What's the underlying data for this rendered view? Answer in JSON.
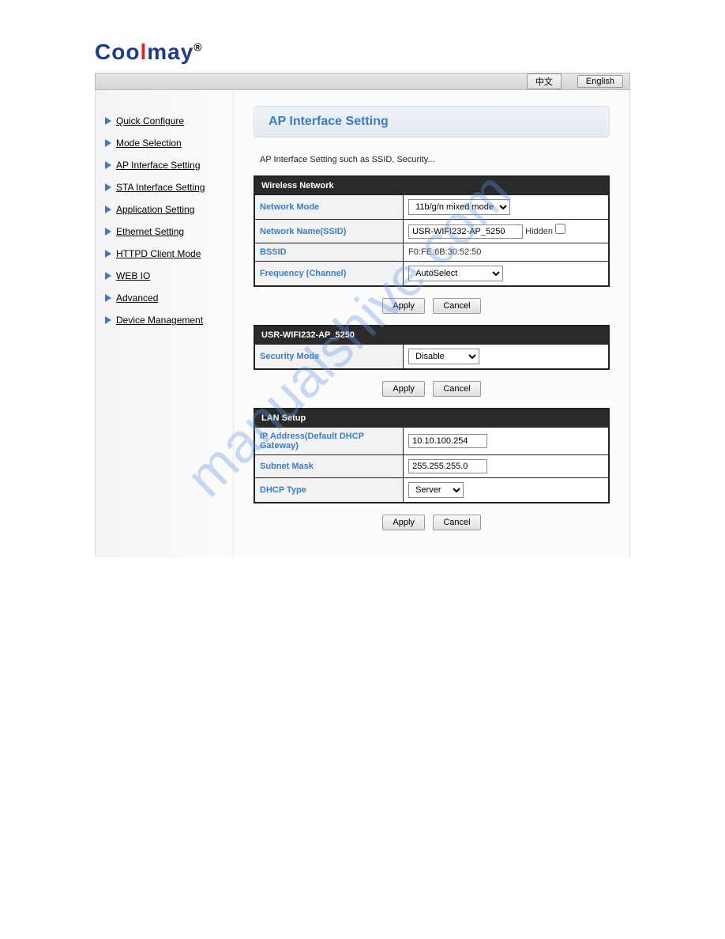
{
  "logo_text": "Coolmay",
  "lang": {
    "chinese": "中文",
    "english": "English"
  },
  "sidebar": {
    "items": [
      {
        "label": "Quick Configure"
      },
      {
        "label": "Mode Selection"
      },
      {
        "label": "AP Interface Setting"
      },
      {
        "label": "STA Interface Setting"
      },
      {
        "label": "Application Setting"
      },
      {
        "label": "Ethernet Setting"
      },
      {
        "label": "HTTPD Client Mode"
      },
      {
        "label": "WEB IO"
      },
      {
        "label": "Advanced"
      },
      {
        "label": "Device Management"
      }
    ]
  },
  "page": {
    "title": "AP Interface Setting",
    "description": "AP Interface Setting such as SSID, Security..."
  },
  "wireless": {
    "head": "Wireless Network",
    "network_mode_label": "Network Mode",
    "network_mode_value": "11b/g/n mixed mode",
    "ssid_label": "Network Name(SSID)",
    "ssid_value": "USR-WIFI232-AP_5250",
    "hidden_label": "Hidden",
    "bssid_label": "BSSID",
    "bssid_value": "F0:FE:6B:30:52:50",
    "frequency_label": "Frequency (Channel)",
    "frequency_value": "AutoSelect"
  },
  "security": {
    "head": "USR-WIFI232-AP_5250",
    "mode_label": "Security Mode",
    "mode_value": "Disable"
  },
  "lan": {
    "head": "LAN Setup",
    "ip_label": "IP Address(Default DHCP Gateway)",
    "ip_value": "10.10.100.254",
    "mask_label": "Subnet Mask",
    "mask_value": "255.255.255.0",
    "dhcp_label": "DHCP Type",
    "dhcp_value": "Server"
  },
  "buttons": {
    "apply": "Apply",
    "cancel": "Cancel"
  },
  "watermark": "manualshive.com"
}
